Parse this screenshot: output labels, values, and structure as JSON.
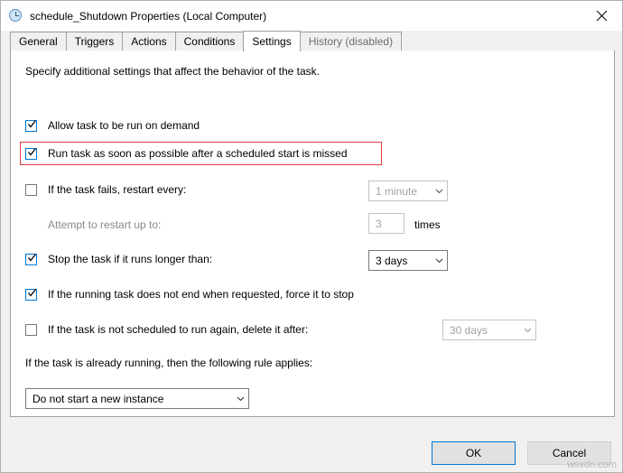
{
  "window": {
    "title": "schedule_Shutdown Properties (Local Computer)",
    "icon": "clock-icon",
    "close_label": "✕"
  },
  "tabs": [
    {
      "label": "General",
      "selected": false,
      "disabled": false
    },
    {
      "label": "Triggers",
      "selected": false,
      "disabled": false
    },
    {
      "label": "Actions",
      "selected": false,
      "disabled": false
    },
    {
      "label": "Conditions",
      "selected": false,
      "disabled": false
    },
    {
      "label": "Settings",
      "selected": true,
      "disabled": false
    },
    {
      "label": "History (disabled)",
      "selected": false,
      "disabled": true
    }
  ],
  "settings": {
    "intro": "Specify additional settings that affect the behavior of the task.",
    "allow_on_demand": {
      "label": "Allow task to be run on demand",
      "checked": true
    },
    "run_asap": {
      "label": "Run task as soon as possible after a scheduled start is missed",
      "checked": true,
      "highlighted": true,
      "highlight_color": "#e23b3b"
    },
    "restart_on_fail": {
      "label": "If the task fails, restart every:",
      "checked": false,
      "value": "1 minute"
    },
    "attempt_restart": {
      "label": "Attempt to restart up to:",
      "value": "3",
      "suffix": "times",
      "enabled": false
    },
    "stop_if_longer": {
      "label": "Stop the task if it runs longer than:",
      "checked": true,
      "value": "3 days"
    },
    "force_stop": {
      "label": "If the running task does not end when requested, force it to stop",
      "checked": true
    },
    "delete_after": {
      "label": "If the task is not scheduled to run again, delete it after:",
      "checked": false,
      "value": "30 days"
    },
    "already_running_label": "If the task is already running, then the following rule applies:",
    "already_running_value": "Do not start a new instance"
  },
  "footer": {
    "ok_label": "OK",
    "cancel_label": "Cancel"
  },
  "watermark": "wsxdn.com"
}
